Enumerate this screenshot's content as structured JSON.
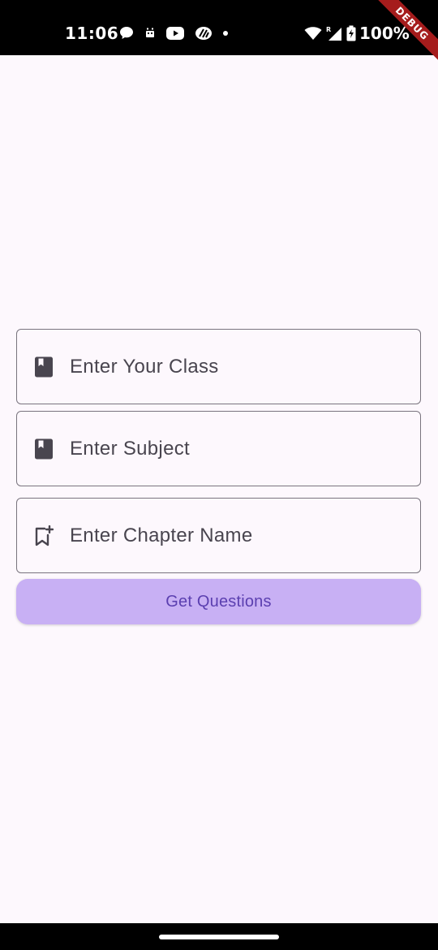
{
  "status_bar": {
    "time": "11:06",
    "notification_icons": [
      "chat-bubble-icon",
      "notification-icon",
      "youtube-icon",
      "app-icon",
      "more-dot-icon"
    ],
    "system_icons": [
      "wifi-icon",
      "cellular-roaming-icon",
      "battery-charging-icon"
    ],
    "battery": "100%"
  },
  "debug_banner": {
    "label": "DEBUG",
    "color": "#a51c1c"
  },
  "form": {
    "class_field": {
      "placeholder": "Enter Your Class",
      "value": "",
      "icon": "book-icon"
    },
    "subject_field": {
      "placeholder": "Enter Subject",
      "value": "",
      "icon": "book-icon"
    },
    "chapter_field": {
      "placeholder": "Enter Chapter Name",
      "value": "",
      "icon": "bookmark-add-icon"
    },
    "submit_label": "Get Questions"
  },
  "colors": {
    "background": "#fdf8fd",
    "field_border": "#79747e",
    "button_bg": "#c8b0f4",
    "button_text": "#5b3fb0",
    "icon": "#49454f"
  }
}
